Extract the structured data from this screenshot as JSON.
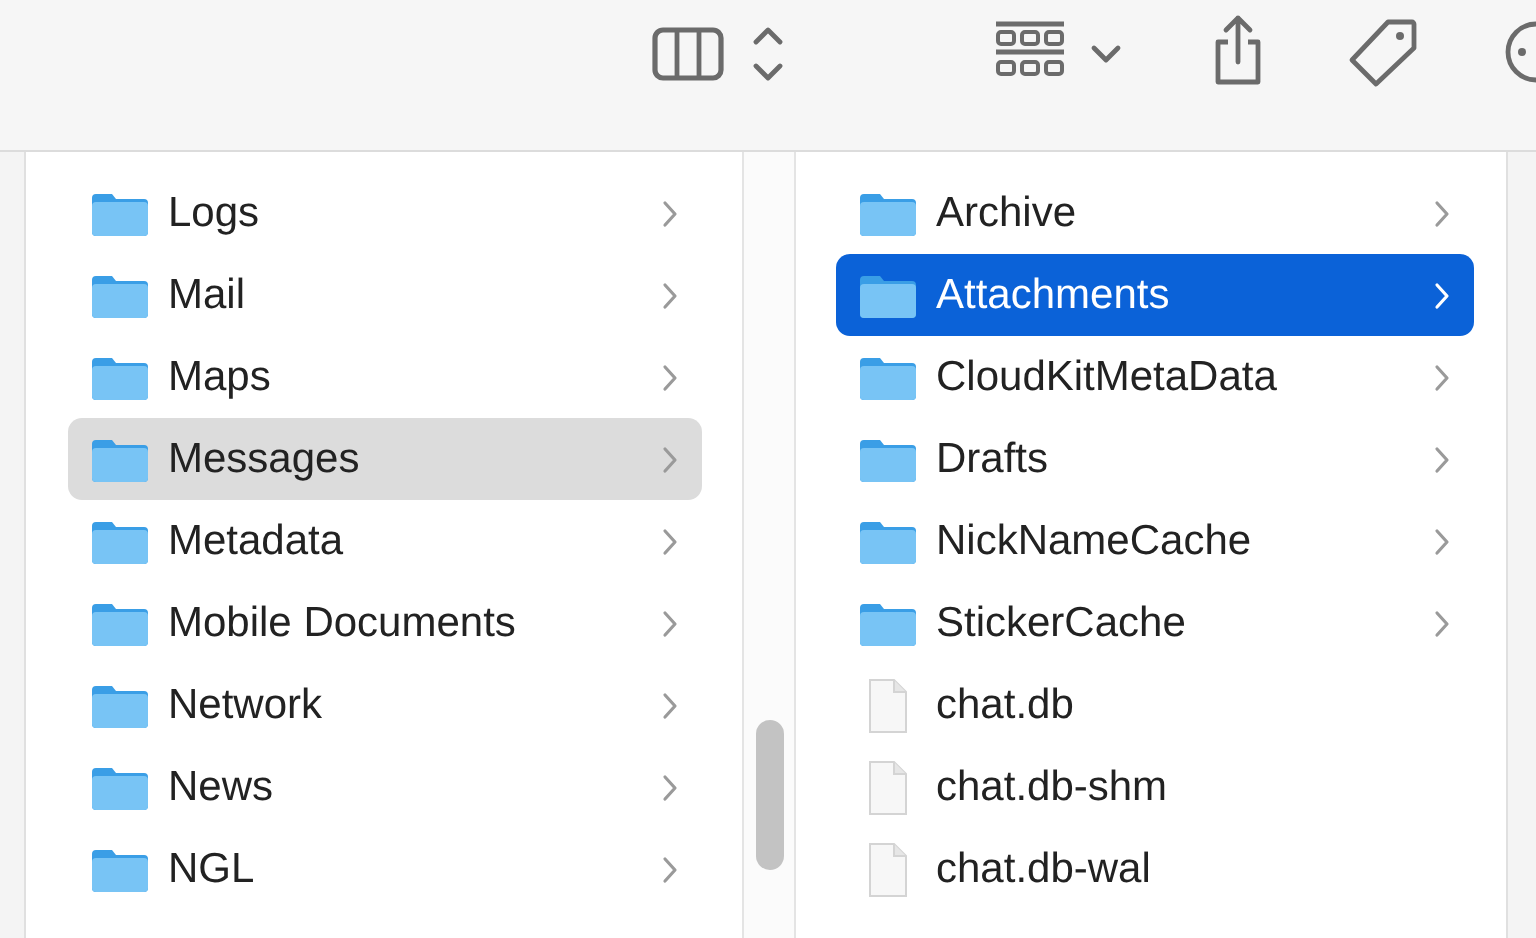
{
  "columns": [
    {
      "focused": false,
      "items": [
        {
          "name": "Logs",
          "kind": "folder",
          "selected": false
        },
        {
          "name": "Mail",
          "kind": "folder",
          "selected": false
        },
        {
          "name": "Maps",
          "kind": "folder",
          "selected": false
        },
        {
          "name": "Messages",
          "kind": "folder",
          "selected": true
        },
        {
          "name": "Metadata",
          "kind": "folder",
          "selected": false
        },
        {
          "name": "Mobile Documents",
          "kind": "folder",
          "selected": false
        },
        {
          "name": "Network",
          "kind": "folder",
          "selected": false
        },
        {
          "name": "News",
          "kind": "folder",
          "selected": false
        },
        {
          "name": "NGL",
          "kind": "folder",
          "selected": false
        }
      ]
    },
    {
      "focused": true,
      "items": [
        {
          "name": "Archive",
          "kind": "folder",
          "selected": false
        },
        {
          "name": "Attachments",
          "kind": "folder",
          "selected": true
        },
        {
          "name": "CloudKitMetaData",
          "kind": "folder",
          "selected": false
        },
        {
          "name": "Drafts",
          "kind": "folder",
          "selected": false
        },
        {
          "name": "NickNameCache",
          "kind": "folder",
          "selected": false
        },
        {
          "name": "StickerCache",
          "kind": "folder",
          "selected": false
        },
        {
          "name": "chat.db",
          "kind": "file",
          "selected": false
        },
        {
          "name": "chat.db-shm",
          "kind": "file",
          "selected": false
        },
        {
          "name": "chat.db-wal",
          "kind": "file",
          "selected": false
        }
      ]
    }
  ]
}
